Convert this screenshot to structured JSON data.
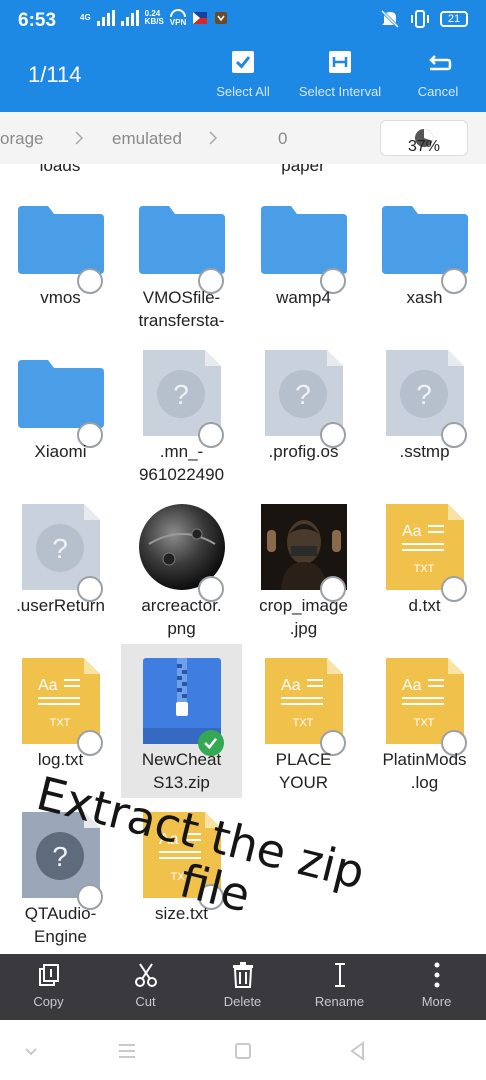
{
  "status": {
    "time": "6:53",
    "network": "4G",
    "speed": "0.24",
    "speed_unit": "KB/S",
    "vpn": "VPN",
    "battery": "21"
  },
  "header": {
    "count": "1/114",
    "select_all": "Select All",
    "select_interval": "Select Interval",
    "cancel": "Cancel"
  },
  "path": {
    "segments": [
      "orage",
      "emulated",
      "0"
    ],
    "storage_usage": "37%"
  },
  "cut_off_labels": [
    "loads",
    "paper"
  ],
  "files": [
    {
      "name": "vmos",
      "type": "folder"
    },
    {
      "name": "VMOSfile-\ntransfersta-",
      "type": "folder"
    },
    {
      "name": "wamp4",
      "type": "folder"
    },
    {
      "name": "xash",
      "type": "folder"
    },
    {
      "name": "Xiaomi",
      "type": "folder"
    },
    {
      "name": ".mn_-\n961022490",
      "type": "unknown"
    },
    {
      "name": ".profig.os",
      "type": "unknown"
    },
    {
      "name": ".sstmp",
      "type": "unknown"
    },
    {
      "name": ".userReturn",
      "type": "unknown"
    },
    {
      "name": "arcreactor.\npng",
      "type": "image-sphere"
    },
    {
      "name": "crop_image\n.jpg",
      "type": "image-person"
    },
    {
      "name": "d.txt",
      "type": "txt"
    },
    {
      "name": "log.txt",
      "type": "txt"
    },
    {
      "name": "NewCheat\nS13.zip",
      "type": "zip",
      "selected": true
    },
    {
      "name": "PLACE\nYOUR",
      "type": "txt"
    },
    {
      "name": "PlatinMods\n.log",
      "type": "txt"
    },
    {
      "name": "QTAudio-\nEngine",
      "type": "unknown-dark"
    },
    {
      "name": "size.txt",
      "type": "txt"
    }
  ],
  "txt_badge": "TXT",
  "txt_glyph": "Aa",
  "overlay_text": {
    "line1": "Extract the zip",
    "line2": "file"
  },
  "toolbar": {
    "copy": "Copy",
    "cut": "Cut",
    "delete": "Delete",
    "rename": "Rename",
    "more": "More"
  },
  "colors": {
    "accent": "#1e88e5",
    "folder": "#4a9ee8",
    "txt": "#f0c14b",
    "unknown": "#c9d1dc",
    "check": "#34a853",
    "toolbar": "#3a3a3e"
  }
}
